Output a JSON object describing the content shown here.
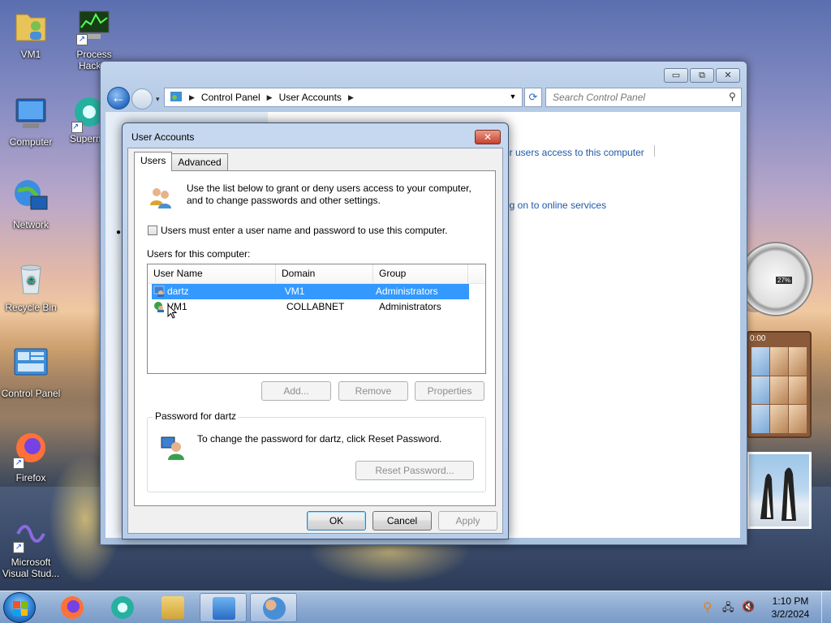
{
  "desktop": {
    "icons": [
      {
        "label": "VM1"
      },
      {
        "label": "Process Hacker"
      },
      {
        "label": "Computer"
      },
      {
        "label": "Supermium"
      },
      {
        "label": "Network"
      },
      {
        "label": "Recycle Bin"
      },
      {
        "label": "Control Panel"
      },
      {
        "label": "Firefox"
      },
      {
        "label": "Microsoft Visual Stud..."
      }
    ]
  },
  "explorer": {
    "breadcrumb": [
      "Control Panel",
      "User Accounts"
    ],
    "search_placeholder": "Search Control Panel",
    "links": [
      "er users access to this computer",
      "og on to online services"
    ],
    "buttons": {
      "minimize": "▭",
      "maximize": "⧉",
      "close": "✕"
    }
  },
  "dialog": {
    "title": "User Accounts",
    "close": "✕",
    "tabs": [
      "Users",
      "Advanced"
    ],
    "intro": "Use the list below to grant or deny users access to your computer, and to change passwords and other settings.",
    "checkbox_label": "Users must enter a user name and password to use this computer.",
    "users_label": "Users for this computer:",
    "columns": [
      "User Name",
      "Domain",
      "Group"
    ],
    "rows": [
      {
        "name": "dartz",
        "domain": "VM1",
        "group": "Administrators",
        "selected": true
      },
      {
        "name": "VM1",
        "domain": "COLLABNET",
        "group": "Administrators",
        "selected": false
      }
    ],
    "list_buttons": {
      "add": "Add...",
      "remove": "Remove",
      "properties": "Properties"
    },
    "password_group_title": "Password for dartz",
    "password_text": "To change the password for dartz, click Reset Password.",
    "reset_password": "Reset Password...",
    "footer": {
      "ok": "OK",
      "cancel": "Cancel",
      "apply": "Apply"
    }
  },
  "gadgets": {
    "cpu_meter_value": "27%",
    "puzzle_time": "0:00"
  },
  "taskbar": {
    "time": "1:10 PM",
    "date": "3/2/2024"
  },
  "colors": {
    "selection": "#3399ff",
    "link": "#1e58a8"
  }
}
